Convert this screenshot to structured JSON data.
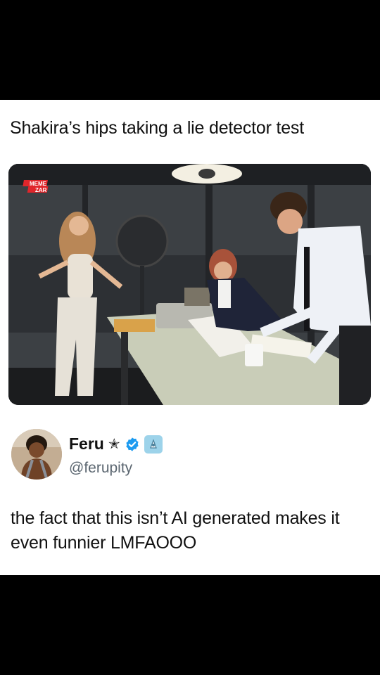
{
  "post": {
    "headline": "Shakira’s hips taking a lie detector test",
    "image_watermark_line1": "MEME",
    "image_watermark_line2": "ZAR"
  },
  "author": {
    "name": "Feru",
    "name_suffix_glyph": "✭",
    "handle": "@ferupity",
    "verified_color": "#1d9bf0",
    "affiliate_badge_color": "#9dd3ea"
  },
  "tweet": {
    "text": "the fact that this isn’t AI generated makes it even funnier LMFAOOO"
  },
  "colors": {
    "letterbox": "#000000",
    "card": "#ffffff",
    "text": "#111111",
    "handle": "#5b6670"
  }
}
